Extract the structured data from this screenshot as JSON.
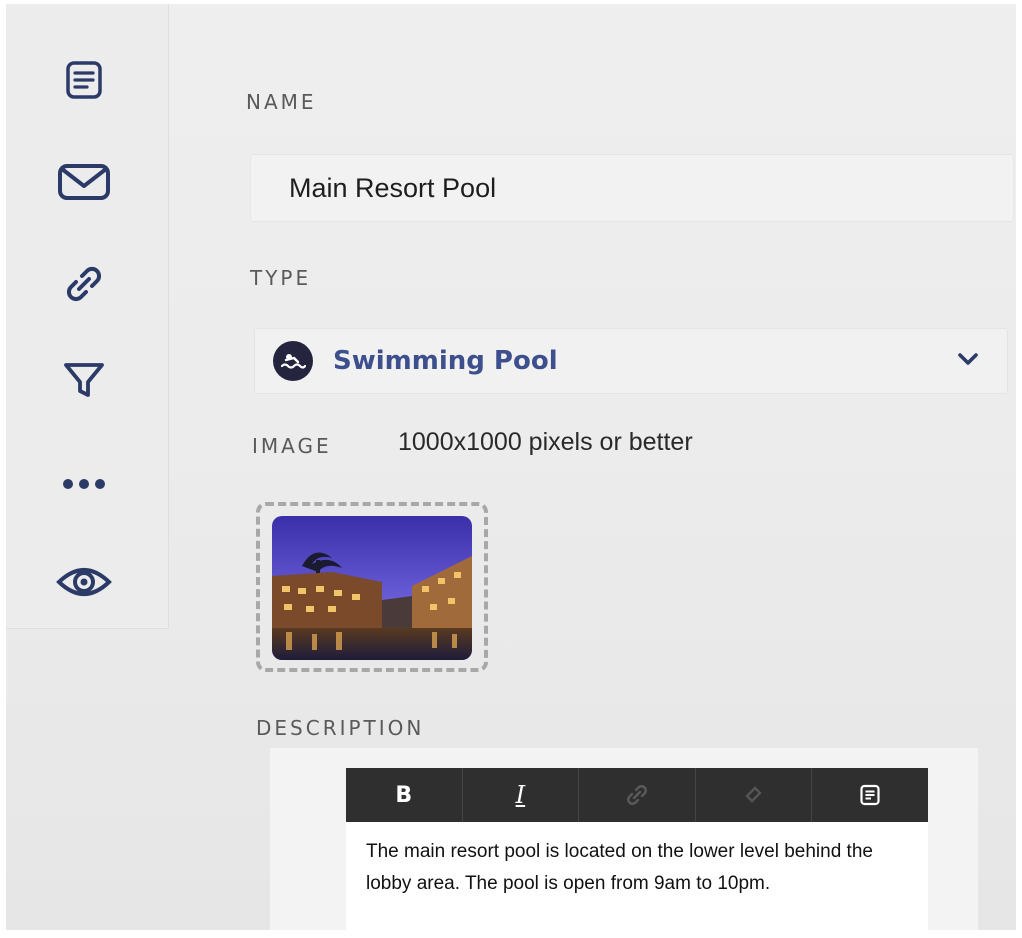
{
  "sidebar": {
    "items": [
      {
        "icon": "document-icon"
      },
      {
        "icon": "mail-icon"
      },
      {
        "icon": "link-icon"
      },
      {
        "icon": "filter-icon"
      },
      {
        "icon": "more-icon"
      },
      {
        "icon": "eye-icon"
      }
    ]
  },
  "form": {
    "name_label": "NAME",
    "name_value": "Main Resort Pool",
    "type_label": "TYPE",
    "type_value": "Swimming Pool",
    "image_label": "IMAGE",
    "image_hint": "1000x1000 pixels or better",
    "description_label": "DESCRIPTION"
  },
  "editor": {
    "toolbar": [
      {
        "icon": "bold-icon",
        "label": "B"
      },
      {
        "icon": "italic-icon",
        "label": "I"
      },
      {
        "icon": "link-icon"
      },
      {
        "icon": "unlink-icon"
      },
      {
        "icon": "document-icon"
      }
    ],
    "description": "The main resort pool is located on the lower level behind the lobby area. The pool is open from 9am to 10pm."
  },
  "colors": {
    "accent": "#3d4f8c",
    "icon": "#2b3a67",
    "toolbar_bg": "#2f2f2f"
  }
}
